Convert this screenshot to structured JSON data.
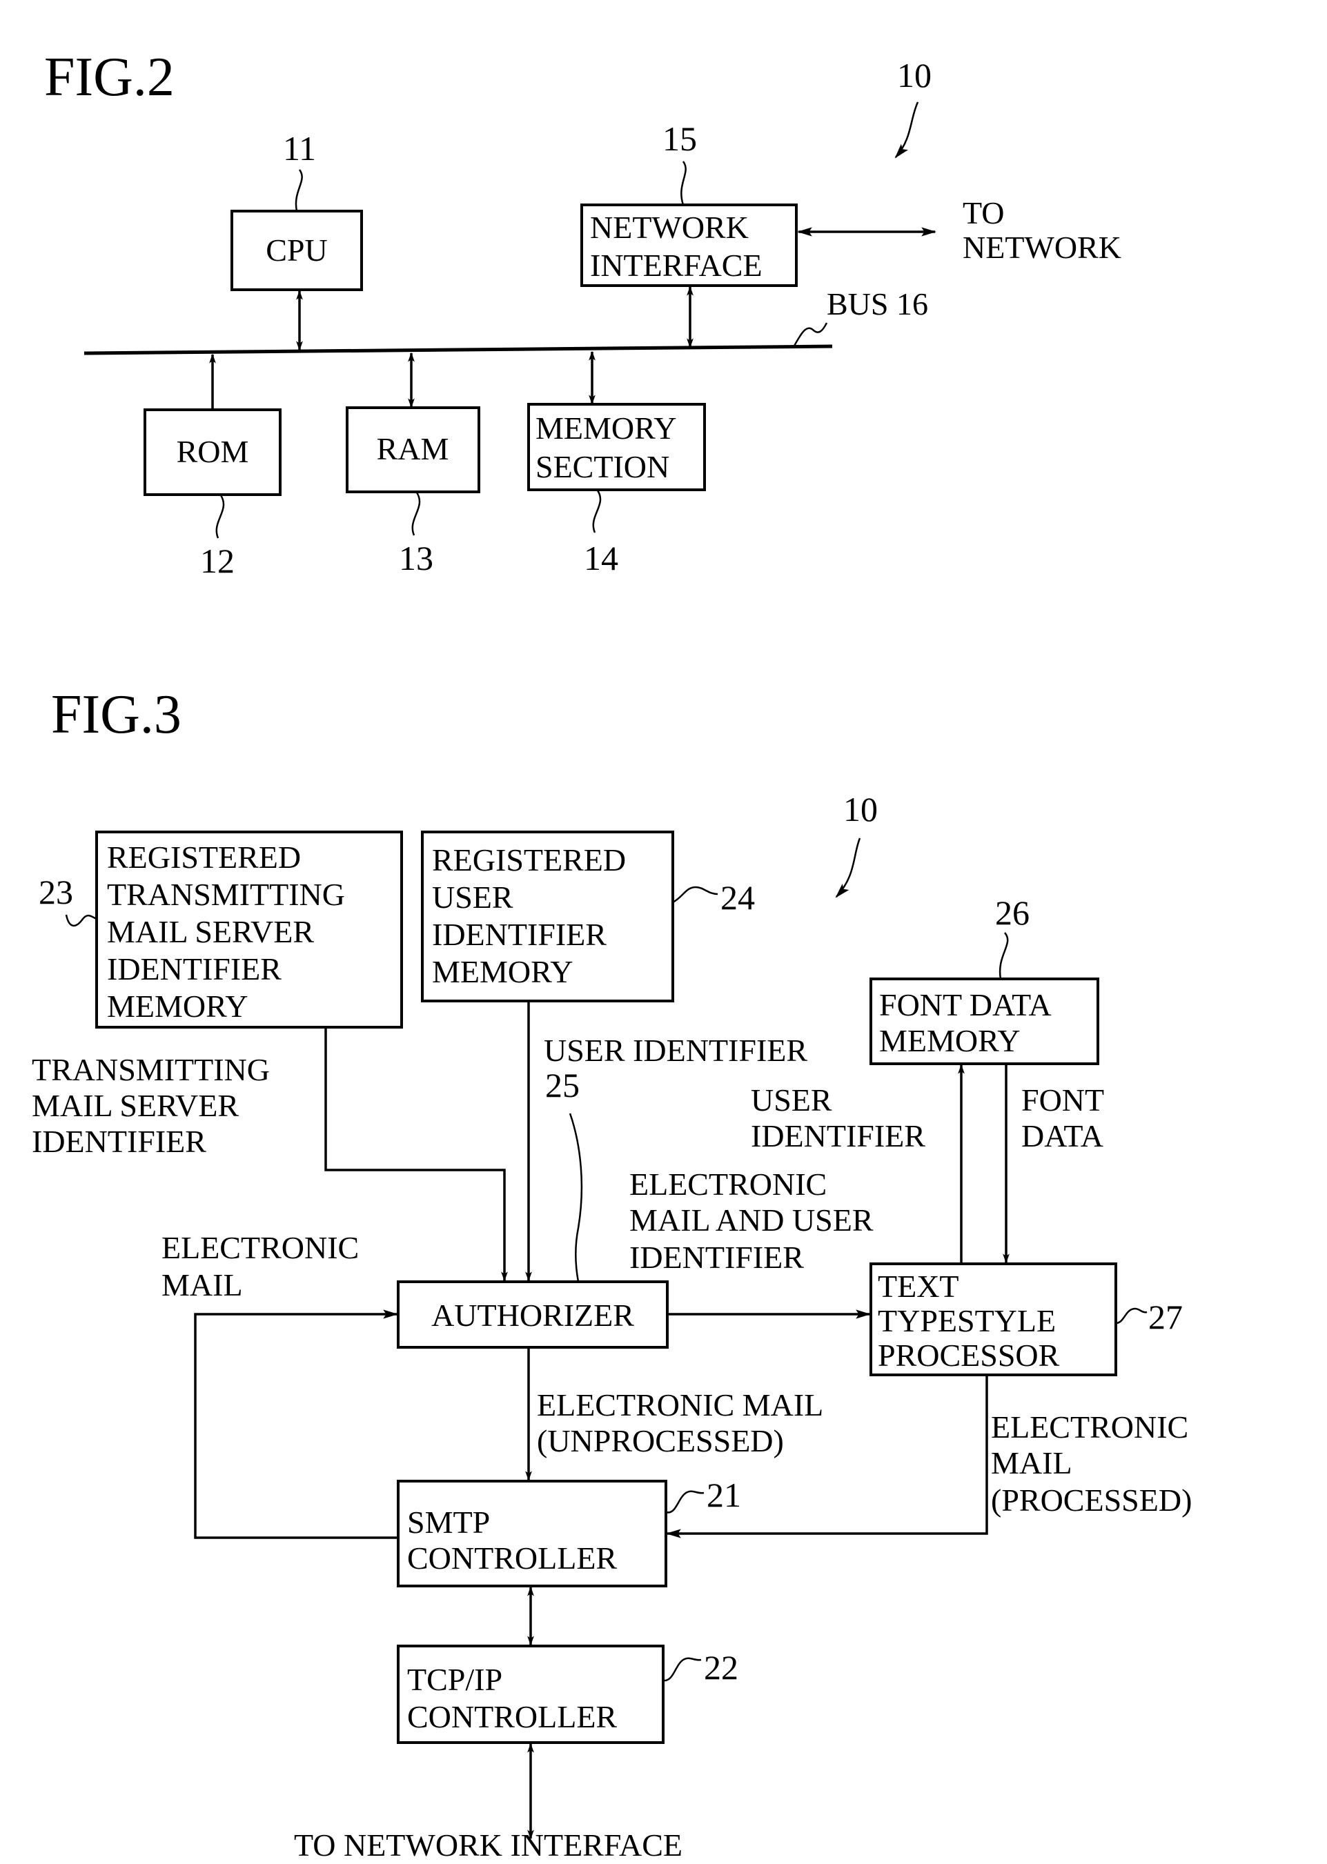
{
  "fig2": {
    "title": "FIG.2",
    "device_ref": "10",
    "bus_label": "BUS 16",
    "to_network": [
      "TO",
      "NETWORK"
    ],
    "blocks": [
      {
        "id": "cpu",
        "ref": "11",
        "lines": [
          "CPU"
        ]
      },
      {
        "id": "network-interface",
        "ref": "15",
        "lines": [
          "NETWORK",
          "INTERFACE"
        ]
      },
      {
        "id": "rom",
        "ref": "12",
        "lines": [
          "ROM"
        ]
      },
      {
        "id": "ram",
        "ref": "13",
        "lines": [
          "RAM"
        ]
      },
      {
        "id": "memory-section",
        "ref": "14",
        "lines": [
          "MEMORY",
          "SECTION"
        ]
      }
    ]
  },
  "fig3": {
    "title": "FIG.3",
    "device_ref": "10",
    "blocks": [
      {
        "id": "registered-transmitting-mail-server-identifier-memory",
        "ref": "23",
        "lines": [
          "REGISTERED",
          "TRANSMITTING",
          "MAIL  SERVER",
          "IDENTIFIER",
          "MEMORY"
        ]
      },
      {
        "id": "registered-user-identifier-memory",
        "ref": "24",
        "lines": [
          "REGISTERED",
          "USER",
          "IDENTIFIER",
          "MEMORY"
        ]
      },
      {
        "id": "font-data-memory",
        "ref": "26",
        "lines": [
          "FONT  DATA",
          "MEMORY"
        ]
      },
      {
        "id": "authorizer",
        "ref": "25",
        "lines": [
          "AUTHORIZER"
        ]
      },
      {
        "id": "text-typestyle-processor",
        "ref": "27",
        "lines": [
          "TEXT",
          "TYPESTYLE",
          "PROCESSOR"
        ]
      },
      {
        "id": "smtp-controller",
        "ref": "21",
        "lines": [
          "SMTP",
          "CONTROLLER"
        ]
      },
      {
        "id": "tcpip-controller",
        "ref": "22",
        "lines": [
          "TCP/IP",
          "CONTROLLER"
        ]
      }
    ],
    "flow_labels": {
      "transmitting_mail_server_identifier": [
        "TRANSMITTING",
        "MAIL  SERVER",
        "IDENTIFIER"
      ],
      "user_identifier_top": [
        "USER  IDENTIFIER"
      ],
      "electronic_mail_in": [
        "ELECTRONIC",
        "MAIL"
      ],
      "email_and_user_identifier": [
        "ELECTRONIC",
        "MAIL  AND  USER",
        "IDENTIFIER"
      ],
      "user_identifier_to_font": [
        "USER",
        "IDENTIFIER"
      ],
      "font_data": [
        "FONT",
        "DATA"
      ],
      "email_unprocessed": [
        "ELECTRONIC  MAIL",
        "(UNPROCESSED)"
      ],
      "email_processed": [
        "ELECTRONIC",
        "MAIL",
        "(PROCESSED)"
      ],
      "to_network_interface": "TO  NETWORK  INTERFACE"
    }
  }
}
